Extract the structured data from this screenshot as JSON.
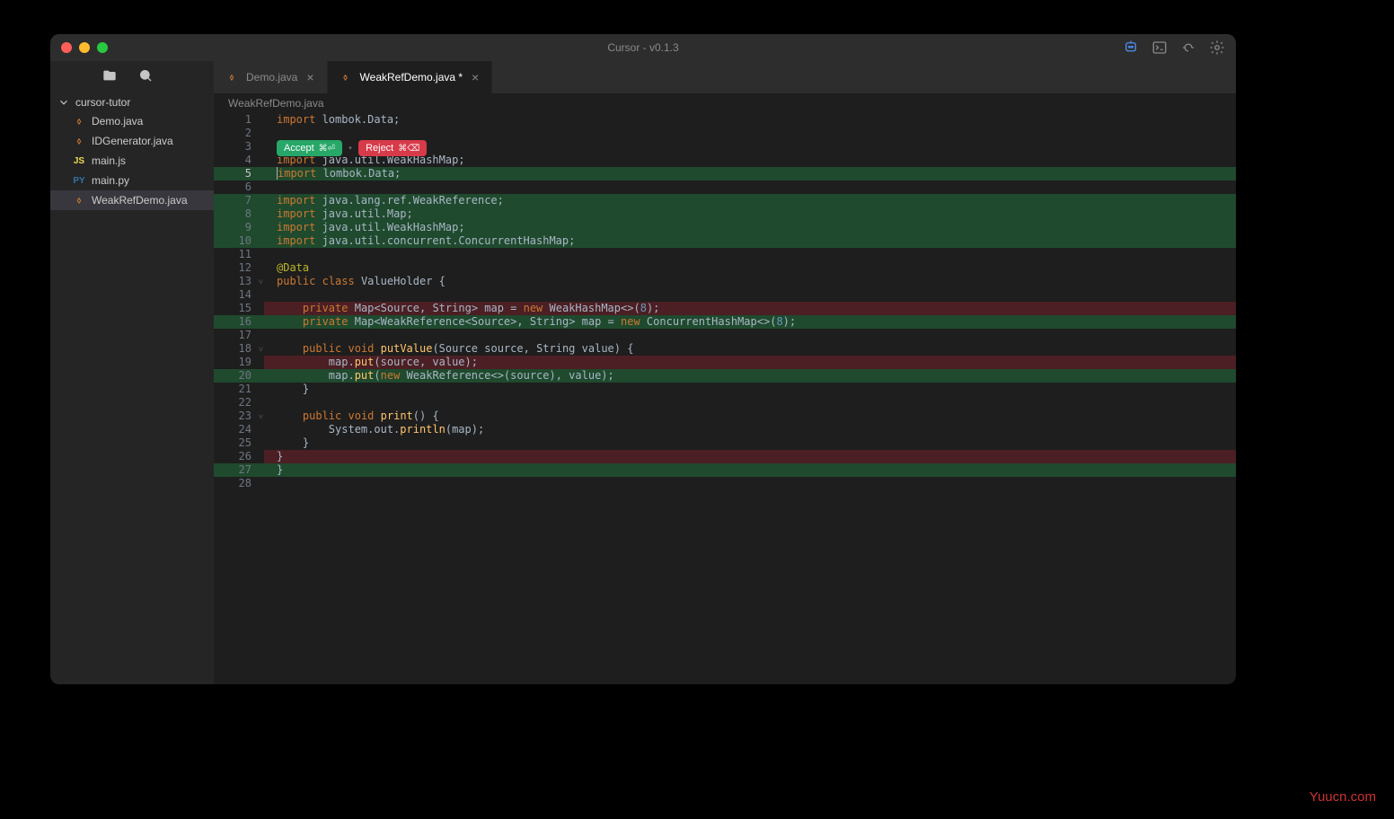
{
  "window": {
    "title": "Cursor - v0.1.3"
  },
  "sidebar": {
    "project": "cursor-tutor",
    "files": [
      {
        "name": "Demo.java",
        "type": "java",
        "active": false
      },
      {
        "name": "IDGenerator.java",
        "type": "java",
        "active": false
      },
      {
        "name": "main.js",
        "type": "js",
        "active": false
      },
      {
        "name": "main.py",
        "type": "py",
        "active": false
      },
      {
        "name": "WeakRefDemo.java",
        "type": "java",
        "active": true
      }
    ]
  },
  "tabs": [
    {
      "label": "Demo.java",
      "active": false,
      "dirty": false
    },
    {
      "label": "WeakRefDemo.java *",
      "active": true,
      "dirty": true
    }
  ],
  "breadcrumb": "WeakRefDemo.java",
  "inline": {
    "accept": "Accept",
    "accept_shortcut": "⌘⏎",
    "reject": "Reject",
    "reject_shortcut": "⌘⌫"
  },
  "code": {
    "lines": [
      "1",
      "2",
      "3",
      "4",
      "5",
      "6",
      "7",
      "8",
      "9",
      "10",
      "11",
      "12",
      "13",
      "14",
      "15",
      "16",
      "17",
      "18",
      "19",
      "20",
      "21",
      "22",
      "23",
      "24",
      "25",
      "26",
      "27",
      "28"
    ],
    "current_line": "5",
    "green_gutter": [
      "5",
      "7",
      "8",
      "9",
      "10",
      "16",
      "20",
      "27"
    ],
    "content": {
      "l1": "import lombok.Data;",
      "l4": "import java.util.WeakHashMap;",
      "l5": "import lombok.Data;",
      "l7": "import java.lang.ref.WeakReference;",
      "l8": "import java.util.Map;",
      "l9": "import java.util.WeakHashMap;",
      "l10": "import java.util.concurrent.ConcurrentHashMap;",
      "l12": "@Data",
      "l13": "public class ValueHolder {",
      "l15": "    private Map<Source, String> map = new WeakHashMap<>(8);",
      "l16": "    private Map<WeakReference<Source>, String> map = new ConcurrentHashMap<>(8);",
      "l18": "    public void putValue(Source source, String value) {",
      "l19": "        map.put(source, value);",
      "l20": "        map.put(new WeakReference<>(source), value);",
      "l21": "    }",
      "l23": "    public void print() {",
      "l24": "        System.out.println(map);",
      "l25": "    }",
      "l26": "}",
      "l27": "}"
    }
  },
  "watermark": "Yuucn.com"
}
